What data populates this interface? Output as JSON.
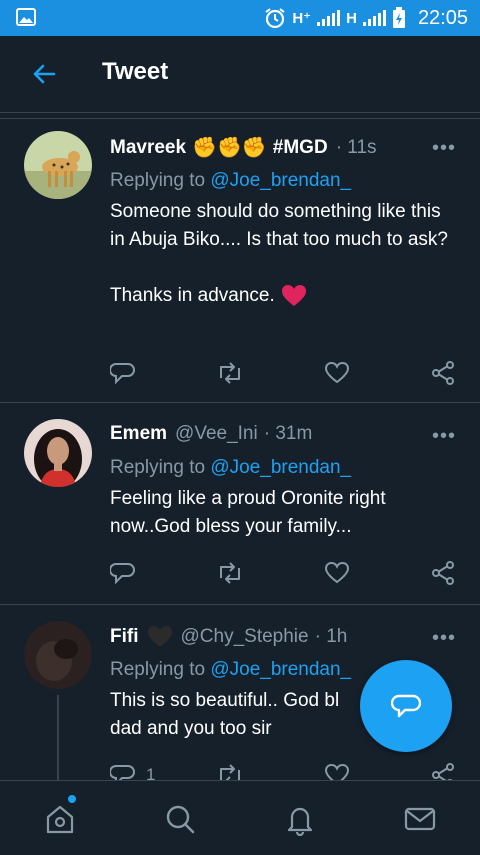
{
  "status_bar": {
    "network_1": "H⁺",
    "network_2": "H",
    "time": "22:05"
  },
  "header": {
    "title": "Tweet",
    "back_icon": "arrow-left-icon"
  },
  "tweets": [
    {
      "name": "Mavreek",
      "emoji": "✊✊✊",
      "name_suffix": "#MGD",
      "handle": "",
      "time": "· 11s",
      "reply_label": "Replying to",
      "reply_to": "@Joe_brendan_",
      "text": "Someone should do something like this in Abuja Biko.... Is that too much to ask?",
      "text2": "Thanks in advance.",
      "heart_emoji": "❤️",
      "reply_count": "",
      "retweet_count": ""
    },
    {
      "name": "Emem",
      "handle": "@Vee_Ini",
      "time": "· 31m",
      "reply_label": "Replying to",
      "reply_to": "@Joe_brendan_",
      "text": "Feeling like a proud Oronite right now..God bless your family...",
      "reply_count": "",
      "retweet_count": ""
    },
    {
      "name": "Fifi",
      "name_emoji": "🖤",
      "handle": "@Chy_Stephie",
      "time": "· 1h",
      "reply_label": "Replying to",
      "reply_to": "@Joe_brendan_",
      "text": "This is so beautiful.. God bl",
      "text_line2": "dad and you too sir",
      "reply_count": "1",
      "retweet_count": ""
    }
  ],
  "colors": {
    "background": "#15202b",
    "accent": "#1da1f2",
    "muted": "#8899a6",
    "status_bar": "#1b8fe0"
  }
}
